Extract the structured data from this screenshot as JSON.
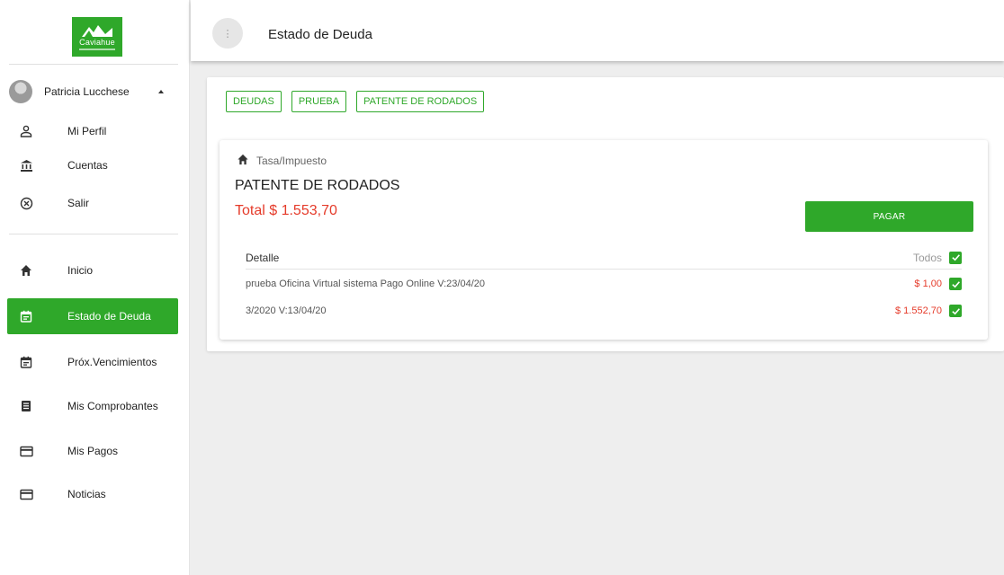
{
  "logo": {
    "text": "Caviahue"
  },
  "user": {
    "name": "Patricia Lucchese"
  },
  "user_menu": [
    {
      "label": "Mi Perfil",
      "icon": "person-icon"
    },
    {
      "label": "Cuentas",
      "icon": "bank-icon"
    },
    {
      "label": "Salir",
      "icon": "close-circle-icon"
    }
  ],
  "nav": [
    {
      "label": "Inicio",
      "icon": "home-icon"
    },
    {
      "label": "Estado de Deuda",
      "icon": "calendar-icon",
      "active": true
    },
    {
      "label": "Próx.Vencimientos",
      "icon": "calendar-icon"
    },
    {
      "label": "Mis Comprobantes",
      "icon": "receipt-icon"
    },
    {
      "label": "Mis Pagos",
      "icon": "credit-card-icon"
    },
    {
      "label": "Noticias",
      "icon": "credit-card-icon"
    }
  ],
  "header": {
    "title": "Estado de Deuda"
  },
  "breadcrumb_chips": [
    "DEUDAS",
    "PRUEBA",
    "PATENTE DE RODADOS"
  ],
  "card": {
    "type_label": "Tasa/Impuesto",
    "title": "PATENTE DE RODADOS",
    "total": "Total $ 1.553,70",
    "pay_label": "PAGAR",
    "detail_header": "Detalle",
    "all_label": "Todos",
    "rows": [
      {
        "description": "prueba Oficina Virtual sistema Pago Online V:23/04/20",
        "amount": "$ 1,00"
      },
      {
        "description": "3/2020 V:13/04/20",
        "amount": "$ 1.552,70"
      }
    ]
  },
  "colors": {
    "accent": "#2fa82a",
    "amount_red": "#e53b2a"
  }
}
